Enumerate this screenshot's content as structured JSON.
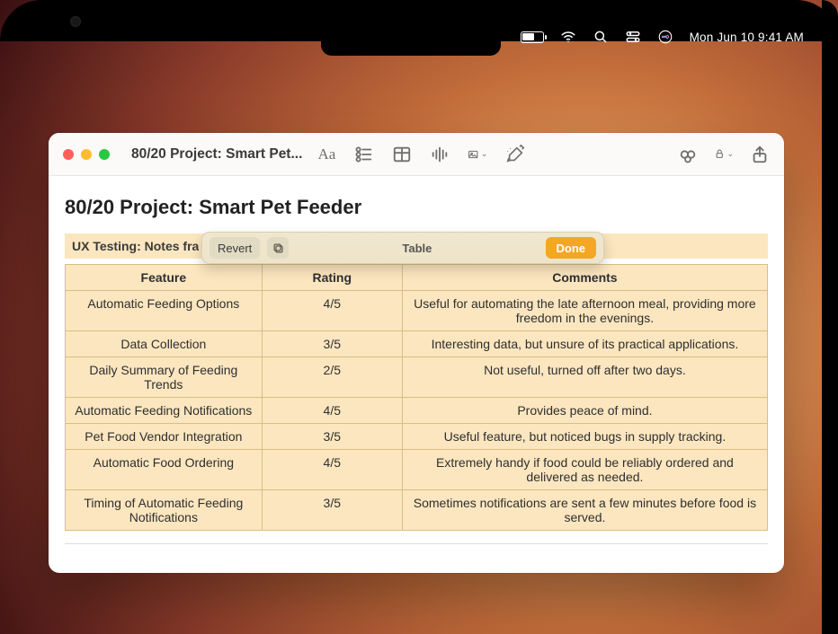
{
  "menubar": {
    "datetime": "Mon Jun 10  9:41 AM"
  },
  "window": {
    "title": "80/20 Project: Smart Pet..."
  },
  "suggest": {
    "revert_label": "Revert",
    "title": "Table",
    "done_label": "Done"
  },
  "page": {
    "title": "80/20 Project: Smart Pet Feeder",
    "subhead": "UX Testing: Notes fra"
  },
  "table": {
    "headers": [
      "Feature",
      "Rating",
      "Comments"
    ],
    "rows": [
      {
        "feature": "Automatic Feeding Options",
        "rating": "4/5",
        "comments": "Useful for automating the late afternoon meal, providing more freedom in the evenings."
      },
      {
        "feature": "Data Collection",
        "rating": "3/5",
        "comments": "Interesting data, but unsure of its practical applications."
      },
      {
        "feature": "Daily Summary of Feeding Trends",
        "rating": "2/5",
        "comments": "Not useful, turned off after two days."
      },
      {
        "feature": "Automatic Feeding Notifications",
        "rating": "4/5",
        "comments": "Provides peace of mind."
      },
      {
        "feature": "Pet Food Vendor Integration",
        "rating": "3/5",
        "comments": "Useful feature, but noticed bugs in supply tracking."
      },
      {
        "feature": "Automatic Food Ordering",
        "rating": "4/5",
        "comments": "Extremely handy if food could be reliably ordered and delivered as needed."
      },
      {
        "feature": "Timing of Automatic Feeding Notifications",
        "rating": "3/5",
        "comments": "Sometimes notifications are sent a few minutes before food is served."
      }
    ]
  }
}
